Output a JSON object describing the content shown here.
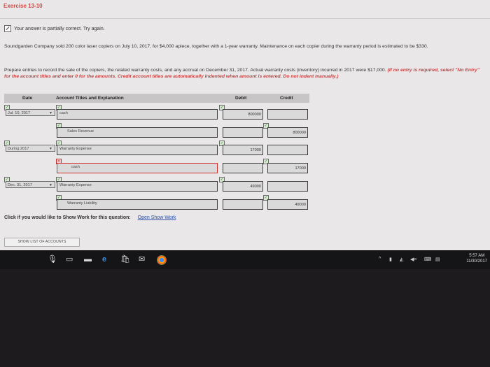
{
  "exercise": {
    "title": "Exercise 13-10"
  },
  "status": {
    "text": "Your answer is partially correct.  Try again."
  },
  "problem": {
    "para1": "Soundgarden Company sold 200 color laser copiers on July 10, 2017, for $4,000 apiece, together with a 1-year warranty. Maintenance on each copier during the warranty period is estimated to be $330.",
    "para2_plain": "Prepare entries to record the sale of the copiers, the related warranty costs, and any accrual on December 31, 2017. Actual warranty costs (inventory) incurred in 2017 were $17,000. ",
    "para2_emphasis": "(If no entry is required, select \"No Entry\" for the account titles and enter 0 for the amounts. Credit account titles are automatically indented when amount is entered. Do not indent manually.)"
  },
  "table": {
    "headers": {
      "date": "Date",
      "account": "Account Titles and Explanation",
      "debit": "Debit",
      "credit": "Credit"
    },
    "rows": [
      {
        "date": "Jul. 10, 2017",
        "account": "cash",
        "debit": "800000",
        "credit": ""
      },
      {
        "date": "",
        "account": "Sales Revenue",
        "debit": "",
        "credit": "800000"
      },
      {
        "date": "During 2017",
        "account": "Warranty Expense",
        "debit": "17000",
        "credit": ""
      },
      {
        "date": "",
        "account": "cash",
        "debit": "",
        "credit": "17000"
      },
      {
        "date": "Dec. 31, 2017",
        "account": "Warranty Expense",
        "debit": "49000",
        "credit": ""
      },
      {
        "date": "",
        "account": "Warranty Liability",
        "debit": "",
        "credit": "49000"
      }
    ]
  },
  "footer": {
    "show_work_prompt": "Click if you would like to Show Work for this question:",
    "show_work_link": "Open Show Work",
    "list_accounts_button": "SHOW LIST OF ACCOUNTS"
  },
  "taskbar": {
    "time": "5:57 AM",
    "date": "11/30/2017"
  }
}
